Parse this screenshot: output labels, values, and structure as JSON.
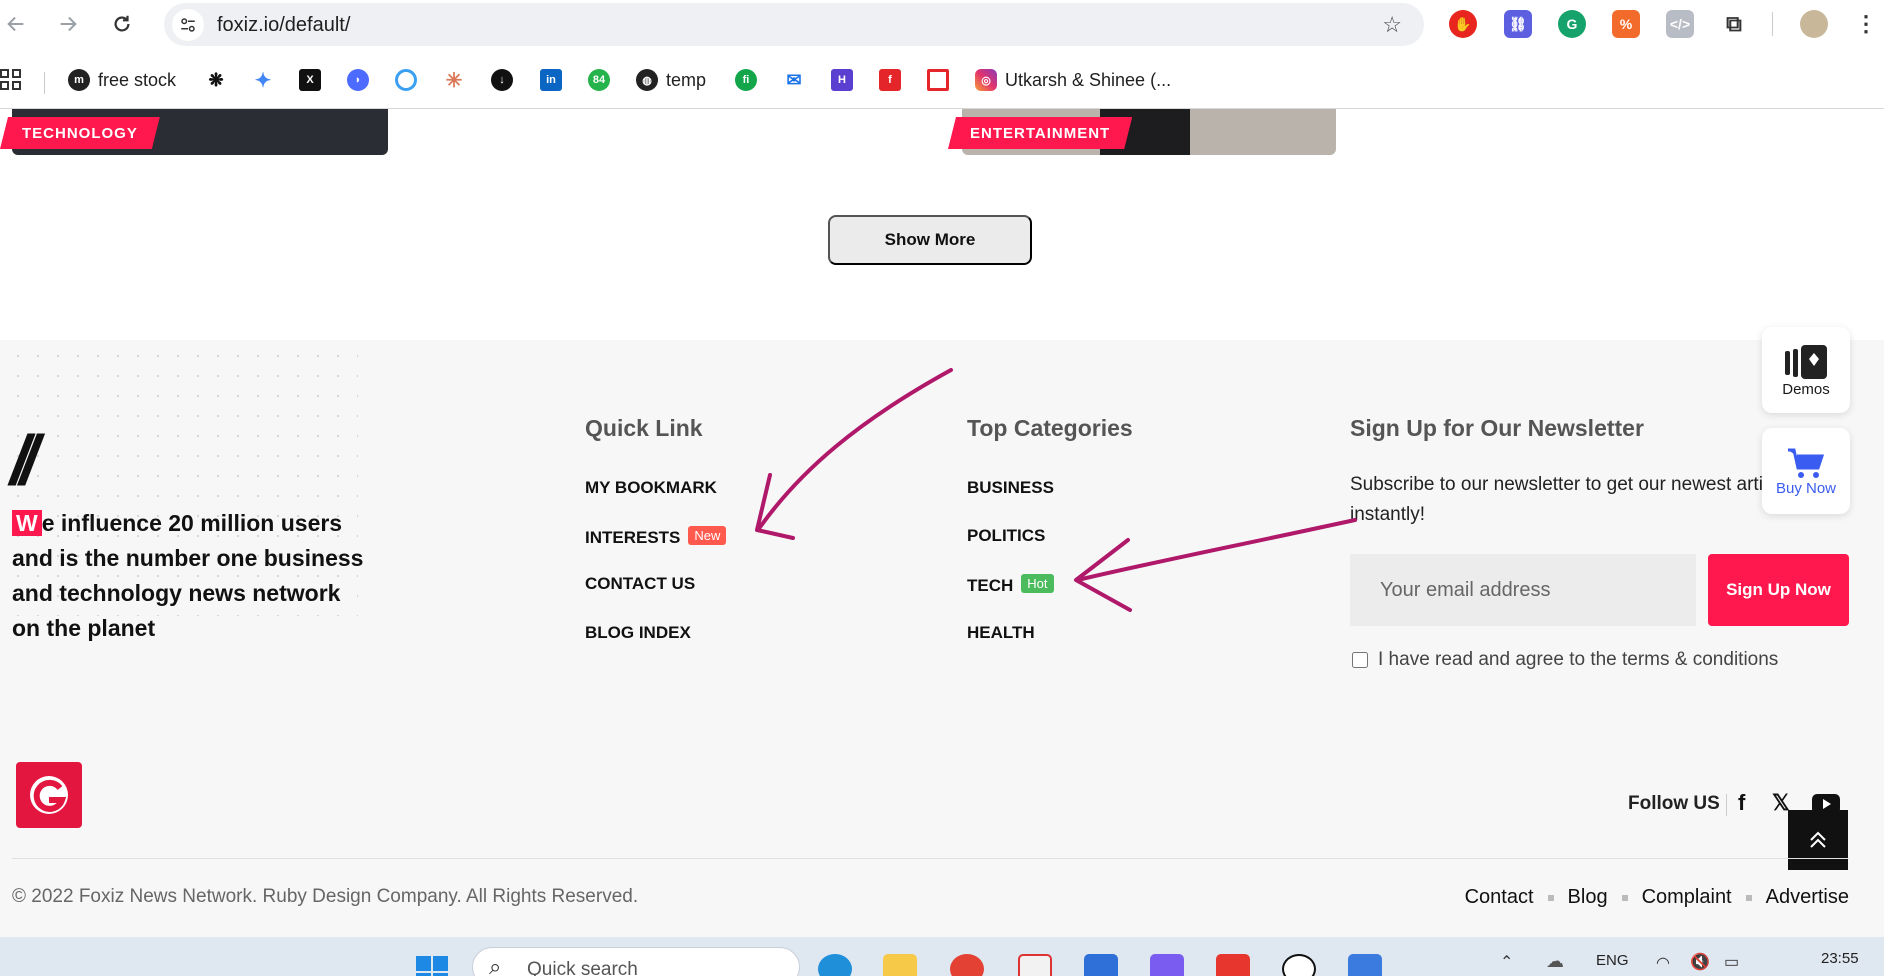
{
  "browser": {
    "url": "foxiz.io/default/",
    "bookmarks": [
      "free stock",
      "temp",
      "Utkarsh & Shinee (..."
    ]
  },
  "page": {
    "categories": [
      "TECHNOLOGY",
      "ENTERTAINMENT"
    ],
    "show_more_label": "Show More",
    "floating": {
      "demos_label": "Demos",
      "buy_label": "Buy Now"
    }
  },
  "footer": {
    "logo_text": "//",
    "tagline_first_letter": "W",
    "tagline_rest": "e influence 20 million users and is the number one business and technology news network on the planet",
    "quick_link": {
      "title": "Quick Link",
      "items": [
        {
          "label": "MY BOOKMARK"
        },
        {
          "label": "INTERESTS",
          "tag": "New"
        },
        {
          "label": "CONTACT US"
        },
        {
          "label": "BLOG INDEX"
        }
      ]
    },
    "top_categories": {
      "title": "Top Categories",
      "items": [
        {
          "label": "BUSINESS"
        },
        {
          "label": "POLITICS"
        },
        {
          "label": "TECH",
          "tag": "Hot"
        },
        {
          "label": "HEALTH"
        }
      ]
    },
    "newsletter": {
      "title": "Sign Up for Our Newsletter",
      "description_line1": "Subscribe to our newsletter to get our newest articl",
      "description_line2": "instantly!",
      "email_placeholder": "Your email address",
      "signup_label": "Sign Up Now",
      "agree_text": "I have read and agree to the terms & conditions"
    },
    "follow_label": "Follow US",
    "copyright": "© 2022 Foxiz News Network. Ruby Design Company. All Rights Reserved.",
    "bottom_links": [
      "Contact",
      "Blog",
      "Complaint",
      "Advertise"
    ]
  },
  "taskbar": {
    "search_placeholder": "Quick search",
    "language": "ENG",
    "time": "23:55"
  },
  "colors": {
    "accent": "#ff184e",
    "tag_new": "#ff5a4d",
    "tag_hot": "#4cbb5e",
    "annotation_arrow": "#b0186a"
  },
  "icons": [
    "back-icon",
    "forward-icon",
    "reload-icon",
    "site-settings-icon",
    "star-icon",
    "apps-grid-icon",
    "facebook-icon",
    "x-icon",
    "youtube-icon",
    "chevron-up-icon",
    "cart-icon",
    "demos-icon",
    "windows-start-icon",
    "search-icon"
  ]
}
